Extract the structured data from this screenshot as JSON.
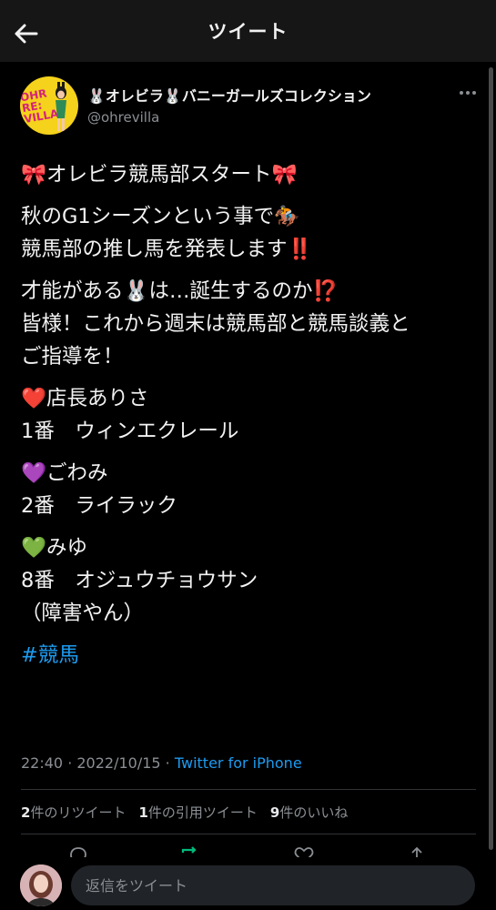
{
  "topbar": {
    "title": "ツイート"
  },
  "tweet": {
    "display_name": "🐰オレビラ🐰バニーガールズコレクション",
    "handle": "@ohrevilla",
    "avatar_text": "OHRE\nVILLA",
    "paragraphs": [
      [
        "🎀オレビラ競馬部スタート🎀"
      ],
      [
        "秋のG1シーズンという事で🏇",
        "競馬部の推し馬を発表します‼️"
      ],
      [
        "才能がある🐰は…誕生するのか⁉️",
        "皆様！これから週末は競馬部と競馬談義と",
        "ご指導を！"
      ],
      [
        "❤️店長ありさ",
        "1番　ウィンエクレール"
      ],
      [
        "💜ごわみ",
        "2番　ライラック"
      ],
      [
        "💚みゆ",
        "8番　オジュウチョウサン",
        "（障害やん）"
      ]
    ],
    "hashtag": "#競馬",
    "time": "22:40",
    "date": "2022/10/15",
    "separator": " · ",
    "source": "Twitter for iPhone"
  },
  "stats": {
    "retweets_count": "2",
    "retweets_label": "件のリツイート",
    "quotes_count": "1",
    "quotes_label": "件の引用ツイート",
    "likes_count": "9",
    "likes_label": "件のいいね"
  },
  "reply": {
    "placeholder": "返信をツイート"
  },
  "colors": {
    "link": "#1d9bf0",
    "background": "#000000",
    "topbar": "#161616",
    "muted": "#8b8f94"
  },
  "icons": [
    "back-arrow-icon",
    "more-icon",
    "reply-icon",
    "retweet-icon",
    "like-icon",
    "share-icon"
  ]
}
